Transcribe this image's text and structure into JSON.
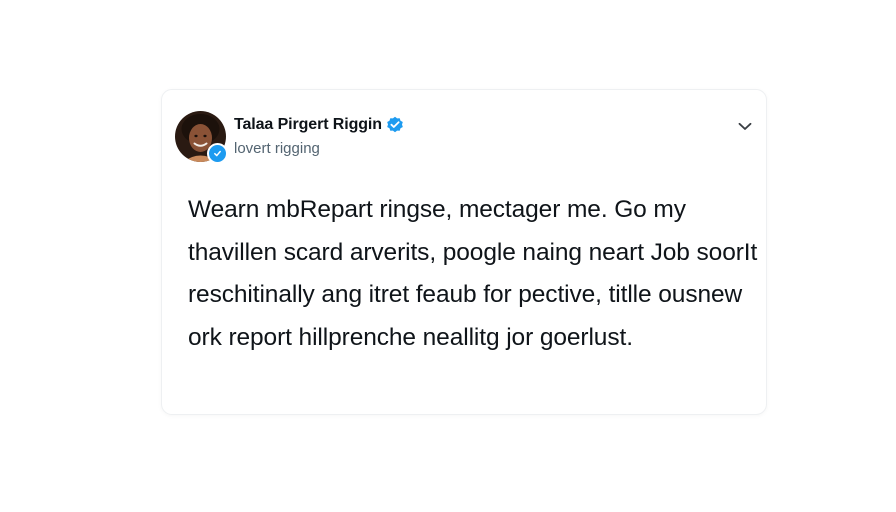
{
  "post": {
    "author": {
      "display_name": "Talaa Pirgert Riggin",
      "handle": "lovert rigging",
      "verified": true,
      "avatar_icon": "person-avatar-icon",
      "badge_icon": "verified-badge-icon"
    },
    "more_icon": "chevron-down-icon",
    "text": "Wearn mbRepart ringse, mectager me. Go my thavillen scard arverits, poogle naing neart Job soorIt reschitinally ang itret feaub for pective, titlle ousnew ork report hillprenche neallitg jor goerlust."
  },
  "colors": {
    "accent": "#1d9bf0",
    "text_primary": "#0f1419",
    "text_secondary": "#536471",
    "card_border": "#eef0f2",
    "background": "#ffffff"
  }
}
